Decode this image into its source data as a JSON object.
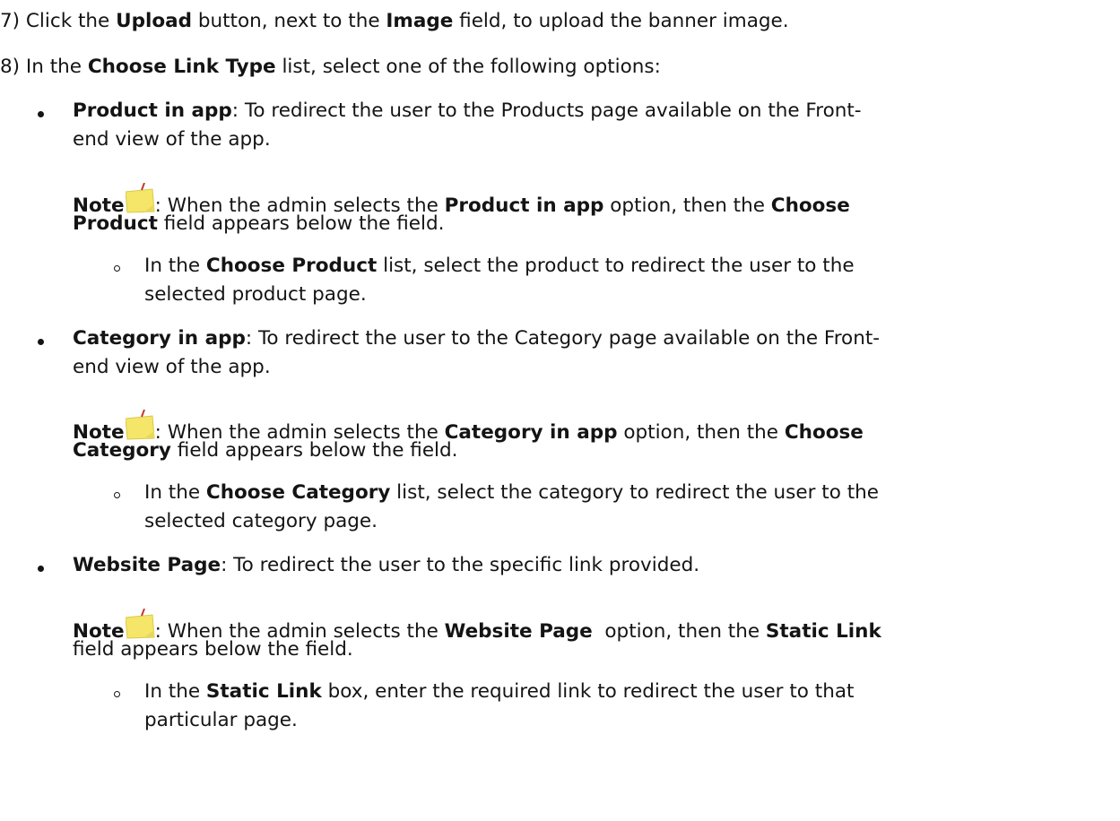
{
  "steps": [
    {
      "number": "7)",
      "text_a": "Click the ",
      "bold_a": "Upload",
      "text_b": " button, next to the ",
      "bold_b": "Image",
      "text_c": " field, to upload the banner image."
    },
    {
      "number": "8)",
      "text_a": "In the ",
      "bold_a": "Choose Link Type",
      "text_b": " list, select one of the following options:"
    }
  ],
  "options": [
    {
      "title": "Product in app",
      "desc_line1": ": To redirect the user to the Products page available on the Front-",
      "desc_line2": "end view of the app.",
      "note_label": "Note",
      "note_a": ": When the admin selects the ",
      "note_bold_a": "Product in app",
      "note_b": " option, then the ",
      "note_bold_b1": "Choose",
      "note_bold_b2": "Product",
      "note_c": " field appears below the field.",
      "sub_a": "In the ",
      "sub_bold": "Choose Product",
      "sub_b": " list, select the product to redirect the user to the",
      "sub_line2": "selected product page."
    },
    {
      "title": "Category in app",
      "desc_line1": ": To redirect the user to the Category page available on the Front-",
      "desc_line2": "end view of the app.",
      "note_label": "Note",
      "note_a": ": When the admin selects the ",
      "note_bold_a": "Category in app",
      "note_b": " option, then the ",
      "note_bold_b1": "Choose",
      "note_bold_b2": "Category",
      "note_c": " field appears below the field.",
      "sub_a": "In the ",
      "sub_bold": "Choose Category",
      "sub_b": " list, select the category to redirect the user to the",
      "sub_line2": "selected category page."
    },
    {
      "title": "Website Page",
      "desc_line1": ": To redirect the user to the specific link provided.",
      "note_label": "Note",
      "note_a": ": When the admin selects the ",
      "note_bold_a": "Website Page",
      "note_b": "  option, then the ",
      "note_bold_b1": "Static Link",
      "note_line2": "field appears below the field.",
      "sub_a": "In the ",
      "sub_bold": "Static Link",
      "sub_b": " box, enter the required link to redirect the user to that",
      "sub_line2": "particular page."
    }
  ],
  "icons": {
    "note": "sticky-note-icon",
    "note_color": "#F5E66A"
  }
}
